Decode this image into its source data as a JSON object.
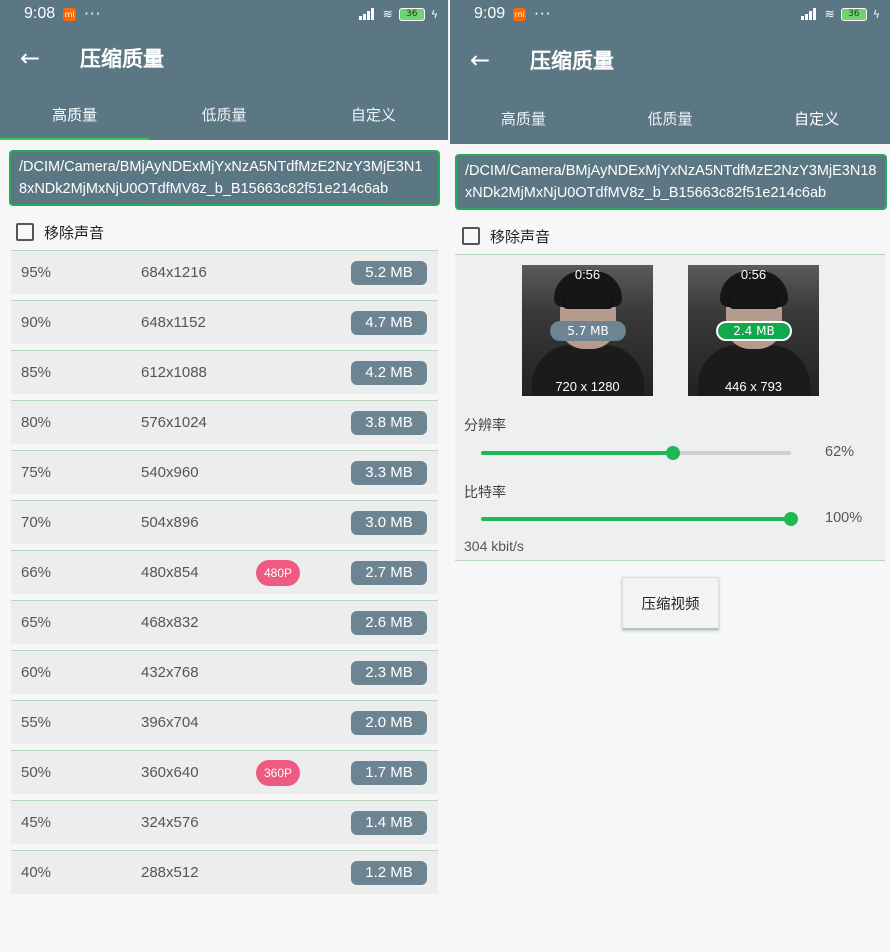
{
  "left": {
    "status": {
      "time": "9:08",
      "dots": "···",
      "battery": "36"
    },
    "appbar": {
      "title": "压缩质量"
    },
    "tabs": [
      "高质量",
      "低质量",
      "自定义"
    ],
    "path": "/DCIM/Camera/BMjAyNDExMjYxNzA5NTdfMzE2NzY3MjE3N18xNDk2MjMxNjU0OTdfMV8z_b_B15663c82f51e214c6ab",
    "mute_label": "移除声音",
    "rows": [
      {
        "pct": "95%",
        "res": "684x1216",
        "badge": "",
        "size": "5.2 MB"
      },
      {
        "pct": "90%",
        "res": "648x1152",
        "badge": "",
        "size": "4.7 MB"
      },
      {
        "pct": "85%",
        "res": "612x1088",
        "badge": "",
        "size": "4.2 MB"
      },
      {
        "pct": "80%",
        "res": "576x1024",
        "badge": "",
        "size": "3.8 MB"
      },
      {
        "pct": "75%",
        "res": "540x960",
        "badge": "",
        "size": "3.3 MB"
      },
      {
        "pct": "70%",
        "res": "504x896",
        "badge": "",
        "size": "3.0 MB"
      },
      {
        "pct": "66%",
        "res": "480x854",
        "badge": "480P",
        "size": "2.7 MB"
      },
      {
        "pct": "65%",
        "res": "468x832",
        "badge": "",
        "size": "2.6 MB"
      },
      {
        "pct": "60%",
        "res": "432x768",
        "badge": "",
        "size": "2.3 MB"
      },
      {
        "pct": "55%",
        "res": "396x704",
        "badge": "",
        "size": "2.0 MB"
      },
      {
        "pct": "50%",
        "res": "360x640",
        "badge": "360P",
        "size": "1.7 MB"
      },
      {
        "pct": "45%",
        "res": "324x576",
        "badge": "",
        "size": "1.4 MB"
      },
      {
        "pct": "40%",
        "res": "288x512",
        "badge": "",
        "size": "1.2 MB"
      }
    ]
  },
  "right": {
    "status": {
      "time": "9:09",
      "dots": "···",
      "battery": "36"
    },
    "appbar": {
      "title": "压缩质量"
    },
    "tabs": [
      "高质量",
      "低质量",
      "自定义"
    ],
    "path": "/DCIM/Camera/BMjAyNDExMjYxNzA5NTdfMzE2NzY3MjE3N18xNDk2MjMxNjU0OTdfMV8z_b_B15663c82f51e214c6ab",
    "mute_label": "移除声音",
    "original": {
      "duration": "0:56",
      "size": "5.7 MB",
      "resolution": "720 x 1280"
    },
    "compressed": {
      "duration": "0:56",
      "size": "2.4 MB",
      "resolution": "446 x 793"
    },
    "resolution_label": "分辨率",
    "resolution_value": "62%",
    "resolution_fraction": 0.62,
    "bitrate_label": "比特率",
    "bitrate_value": "100%",
    "bitrate_fraction": 1.0,
    "bitrate_text": "304 kbit/s",
    "compress_button": "压缩视频"
  },
  "colors": {
    "appbar": "#5c7784",
    "accent_green": "#1db954",
    "badge_pink": "#ef5a82",
    "size_pill": "#6d8592",
    "original_pill": "#6d8592",
    "compressed_pill": "#12a84c"
  },
  "icons": [
    "back-arrow-icon",
    "signal-icon",
    "wifi-icon",
    "battery-icon",
    "mi-notification-icon",
    "checkbox-icon"
  ]
}
